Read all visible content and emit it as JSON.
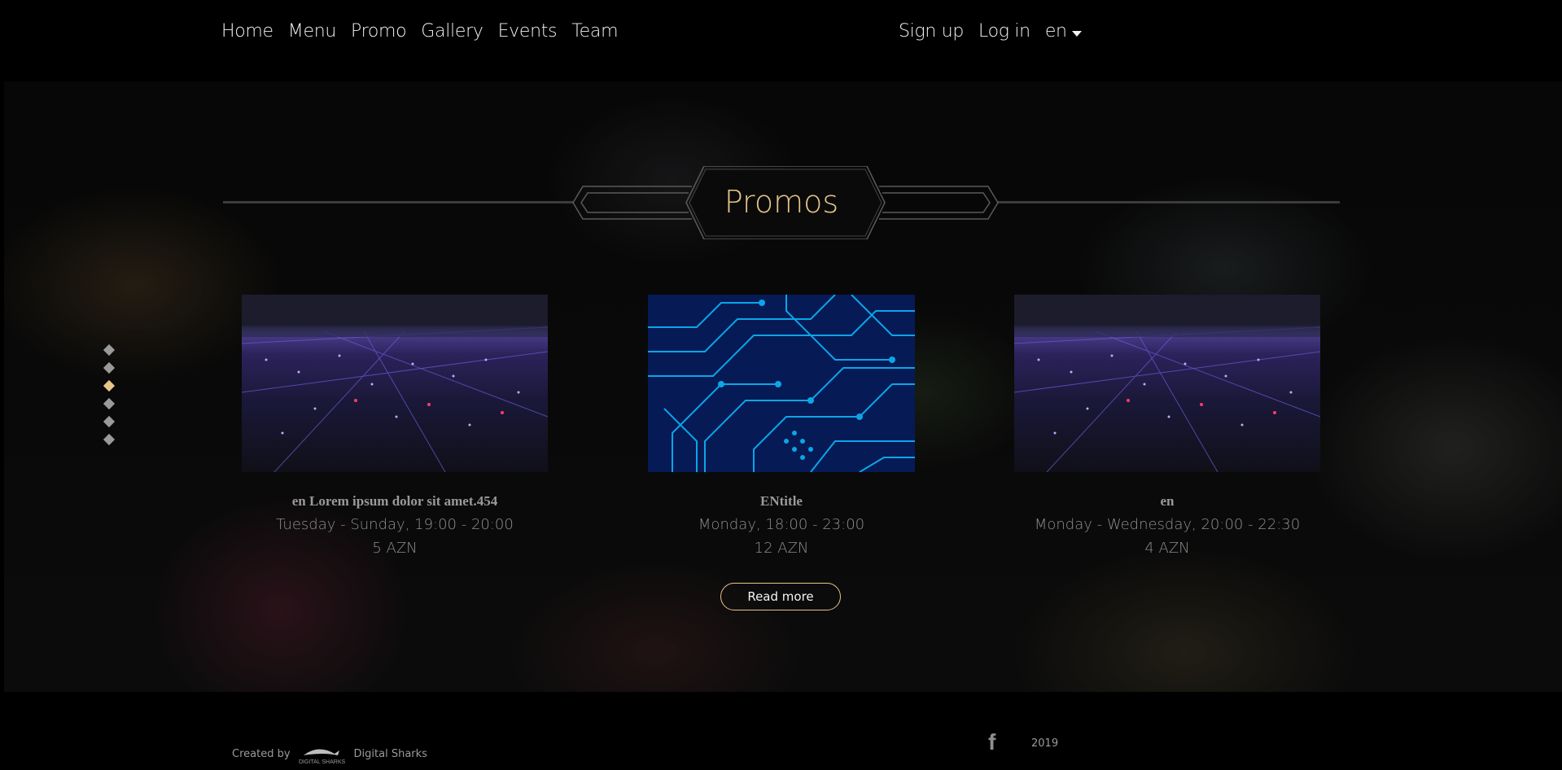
{
  "nav": {
    "items": [
      {
        "label": "Home"
      },
      {
        "label": "Menu"
      },
      {
        "label": "Promo"
      },
      {
        "label": "Gallery"
      },
      {
        "label": "Events"
      },
      {
        "label": "Team"
      }
    ]
  },
  "auth": {
    "signup": "Sign up",
    "login": "Log in",
    "language": "en"
  },
  "section": {
    "title": "Promos"
  },
  "carousel": {
    "dot_count": 6,
    "active_index": 2
  },
  "promos": [
    {
      "title": "en Lorem ipsum dolor sit amet.454",
      "schedule": "Tuesday - Sunday, 19:00 - 20:00",
      "price": "5 AZN",
      "image": "city-lights"
    },
    {
      "title": "ENtitle",
      "schedule": "Monday, 18:00 - 23:00",
      "price": "12 AZN",
      "image": "circuit-board"
    },
    {
      "title": "en",
      "schedule": "Monday - Wednesday, 20:00 - 22:30",
      "price": "4 AZN",
      "image": "city-lights"
    }
  ],
  "read_more": "Read more",
  "footer": {
    "created_by": "Created by",
    "logo_text": "DIGITAL SHARKS",
    "company": "Digital Sharks",
    "social_icon": "facebook-icon",
    "social_glyph": "f",
    "year": "2019"
  },
  "colors": {
    "accent": "#e6c689",
    "background": "#000000",
    "circuit": "#0aa6e8"
  }
}
